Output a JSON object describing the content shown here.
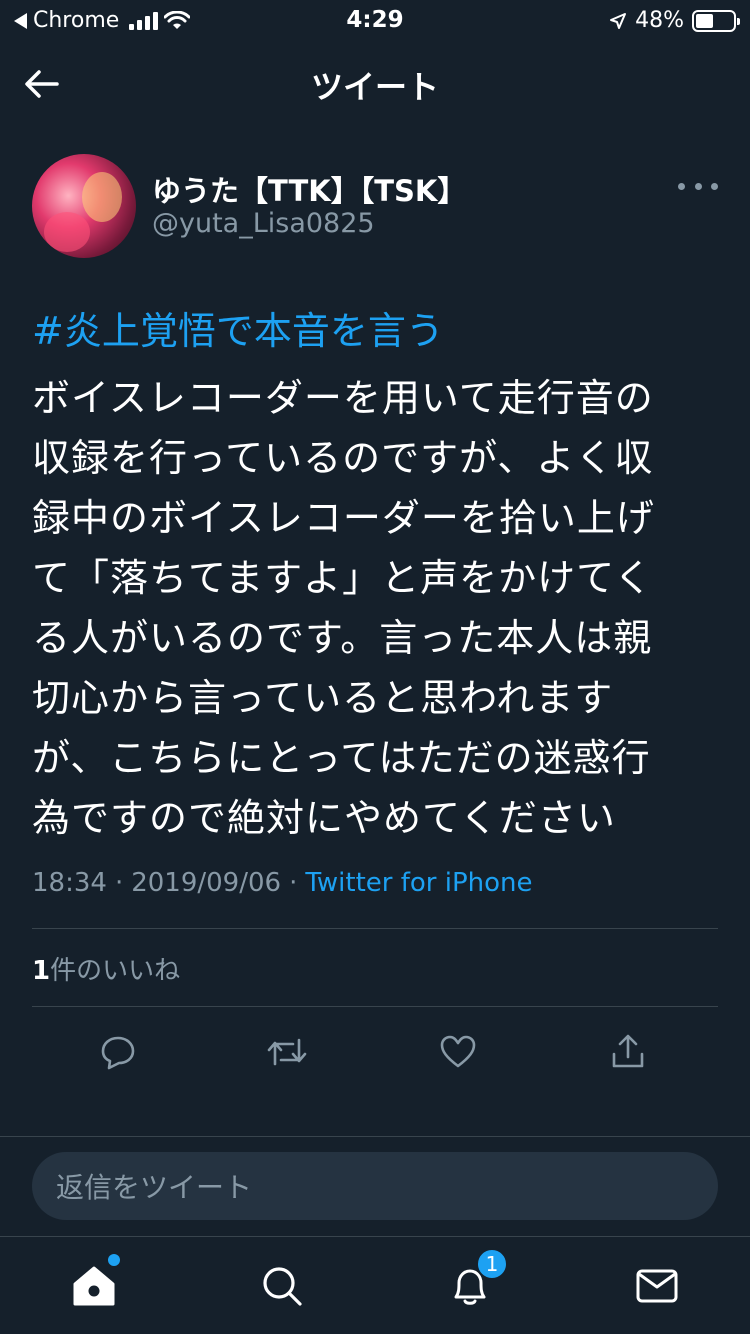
{
  "status_bar": {
    "back_app": "Chrome",
    "time": "4:29",
    "battery": "48%",
    "battery_level": 0.48
  },
  "header": {
    "title": "ツイート"
  },
  "tweet": {
    "author_name": "ゆうた【TTK】【TSK】",
    "author_handle": "@yuta_Lisa0825",
    "hashtag": "#炎上覚悟で本音を言う",
    "lines": [
      "ボイスレコーダーを用いて走行音の",
      "収録を行っているのですが、よく収",
      "録中のボイスレコーダーを拾い上げ",
      "て「落ちてますよ」と声をかけてく",
      "る人がいるのです。言った本人は親",
      "切心から言っていると思われます",
      "が、こちらにとってはただの迷惑行",
      "為ですので絶対にやめてください"
    ],
    "time": "18:34",
    "date": "2019/09/06",
    "separator": "·",
    "source": "Twitter for iPhone",
    "likes_count": "1",
    "likes_label": "件のいいね"
  },
  "actions": {
    "reply": "reply-icon",
    "retweet": "retweet-icon",
    "like": "heart-icon",
    "share": "share-icon"
  },
  "reply_box": {
    "placeholder": "返信をツイート"
  },
  "tabbar": {
    "notifications_badge": "1"
  },
  "colors": {
    "background": "#15202b",
    "accent": "#1da1f2",
    "muted": "#8899a6",
    "divider": "#38444d"
  }
}
